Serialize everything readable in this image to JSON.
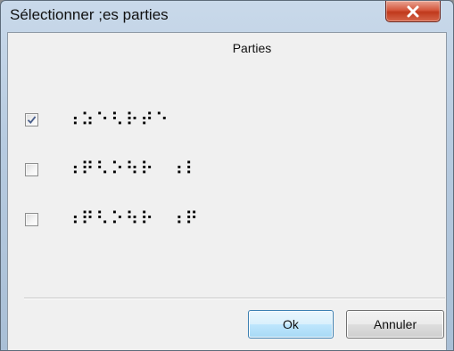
{
  "window": {
    "title": "Sélectionner ;es parties"
  },
  "icons": {
    "close": "close-icon",
    "check": "checkmark-icon"
  },
  "parts": {
    "heading": "Parties",
    "items": [
      {
        "checked": true,
        "braille": "⠰⠵⠑⠣⠗⠞⠑"
      },
      {
        "checked": false,
        "braille": "⠰⠟⠣⠕⠳⠗⠀⠰⠇"
      },
      {
        "checked": false,
        "braille": "⠰⠟⠣⠕⠳⠗⠀⠰⠟"
      }
    ]
  },
  "buttons": {
    "ok": "Ok",
    "cancel": "Annuler"
  },
  "colors": {
    "close_button": "#c9442a",
    "default_button_border": "#3c7fb1",
    "dialog_background": "#f0f0f0"
  }
}
